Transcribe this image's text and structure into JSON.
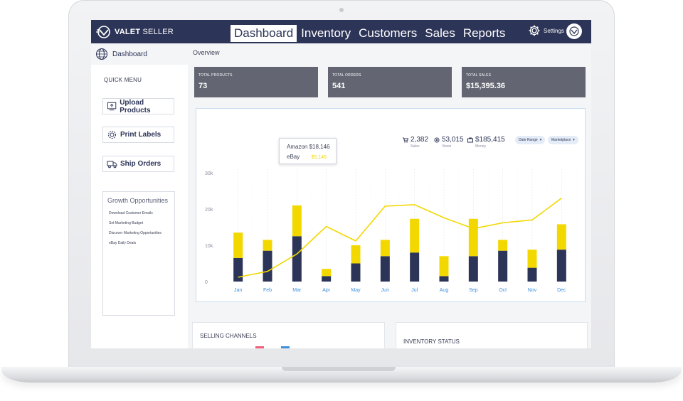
{
  "brand": {
    "logo_bold": "VALET",
    "logo_thin": "SELLER"
  },
  "nav": {
    "items": [
      {
        "label": "Dashboard",
        "active": true
      },
      {
        "label": "Inventory",
        "active": false
      },
      {
        "label": "Customers",
        "active": false
      },
      {
        "label": "Sales",
        "active": false
      },
      {
        "label": "Reports",
        "active": false
      }
    ],
    "settings_label": "Settings"
  },
  "sidebar": {
    "header_label": "Dashboard",
    "quick_menu_title": "QUICK MENU",
    "quick_buttons": [
      {
        "label": "Upload Products",
        "icon": "upload-icon"
      },
      {
        "label": "Print Labels",
        "icon": "gear-icon"
      },
      {
        "label": "Ship Orders",
        "icon": "truck-icon"
      }
    ],
    "growth_title": "Growth Opportunities",
    "growth_items": [
      "Download Customer Emails",
      "Set Marketing Budget",
      "Discover Marketing Opportunities",
      "eBay Daily Deals"
    ]
  },
  "main": {
    "overview_label": "Overview",
    "stats": [
      {
        "title": "TOTAL PRODUCTS",
        "value": "73"
      },
      {
        "title": "TOTAL ORDERS",
        "value": "541"
      },
      {
        "title": "TOTAL SALES",
        "value": "$15,395.36"
      }
    ],
    "kpis": [
      {
        "value": "2,382",
        "label": "Sales",
        "icon": "cart-icon"
      },
      {
        "value": "53,015",
        "label": "Views",
        "icon": "eye-icon"
      },
      {
        "value": "$185,415",
        "label": "Money",
        "icon": "money-icon"
      }
    ],
    "filters": [
      {
        "label": "Date Range"
      },
      {
        "label": "Marketplace"
      }
    ],
    "tooltip": {
      "row1_label": "Amazon",
      "row1_value": "$18,146",
      "row2_label": "eBay",
      "row2_value": "$5,146"
    },
    "bottom_cards": [
      {
        "title": "SELLING CHANNELS"
      },
      {
        "title": "INVENTORY STATUS"
      }
    ]
  },
  "colors": {
    "navy": "#2c3457",
    "yellow": "#f3d800",
    "stat_bg": "#636672"
  },
  "chart_data": {
    "type": "bar",
    "categories": [
      "Jan",
      "Feb",
      "Mar",
      "Apr",
      "May",
      "Jun",
      "Jul",
      "Aug",
      "Sep",
      "Oct",
      "Nov",
      "Dec"
    ],
    "series": [
      {
        "name": "Amazon",
        "kind": "bar",
        "stack": "s",
        "values": [
          6500,
          8500,
          12500,
          1500,
          5000,
          7000,
          8000,
          1500,
          7000,
          8500,
          3800,
          8800
        ]
      },
      {
        "name": "eBay",
        "kind": "bar",
        "stack": "s",
        "values": [
          7000,
          3000,
          8500,
          2000,
          5000,
          4500,
          9300,
          5500,
          10300,
          3000,
          5000,
          7000
        ]
      },
      {
        "kind": "line",
        "values": [
          1200,
          2800,
          7600,
          15200,
          11200,
          20800,
          21200,
          17600,
          14600,
          16200,
          17000,
          23000
        ]
      }
    ],
    "yticks": [
      "0",
      "10k",
      "20k",
      "30k"
    ],
    "ylim": [
      0,
      30000
    ],
    "grid": true
  }
}
